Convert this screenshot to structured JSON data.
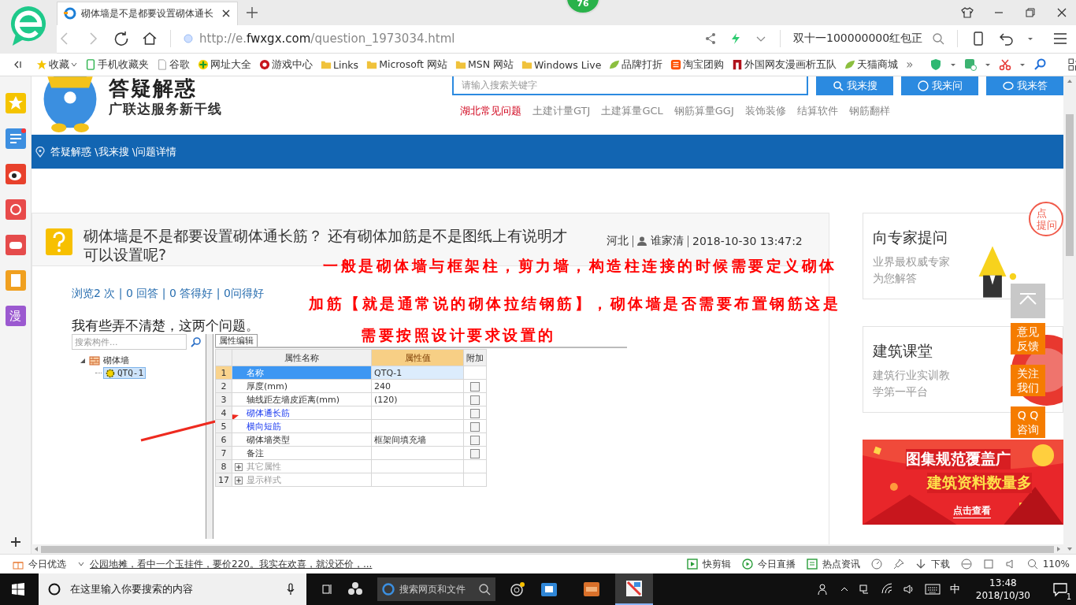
{
  "browser": {
    "tab_title": "砌体墙是不是都要设置砌体通长",
    "badge": "76",
    "url_prefix": "http://e.",
    "url_domain": "fwxgx.com",
    "url_path": "/question_1973034.html",
    "search_value": "双十一100000000红包正"
  },
  "bookmarks": [
    {
      "label": "收藏",
      "kind": "star"
    },
    {
      "label": "手机收藏夹",
      "kind": "phone"
    },
    {
      "label": "谷歌",
      "kind": "page"
    },
    {
      "label": "网址大全",
      "kind": "plus"
    },
    {
      "label": "游戏中心",
      "kind": "game"
    },
    {
      "label": "Links",
      "kind": "folder"
    },
    {
      "label": "Microsoft 网站",
      "kind": "folder"
    },
    {
      "label": "MSN 网站",
      "kind": "folder"
    },
    {
      "label": "Windows Live",
      "kind": "folder"
    },
    {
      "label": "品牌打折",
      "kind": "leaf"
    },
    {
      "label": "淘宝团购",
      "kind": "tao"
    },
    {
      "label": "外国网友漫画析五队",
      "kind": "flag"
    },
    {
      "label": "天猫商城",
      "kind": "leaf"
    }
  ],
  "bookmarks_more": "»",
  "rail_label": "漫",
  "site": {
    "title": "答疑解惑",
    "subtitle": "广联达服务新干线",
    "search_placeholder": "请输入搜索关键字",
    "buttons": [
      "我来搜",
      "我来问",
      "我来答"
    ],
    "links": [
      {
        "label": "湖北常见问题",
        "selected": true
      },
      {
        "label": "土建计量GTJ",
        "selected": false
      },
      {
        "label": "土建算量GCL",
        "selected": false
      },
      {
        "label": "钢筋算量GGJ",
        "selected": false
      },
      {
        "label": "装饰装修",
        "selected": false
      },
      {
        "label": "结算软件",
        "selected": false
      },
      {
        "label": "钢筋翻样",
        "selected": false
      }
    ],
    "breadcrumb": "答疑解惑 \\我来搜 \\问题详情"
  },
  "question": {
    "title": "砌体墙是不是都要设置砌体通长筋？ 还有砌体加筋是不是图纸上有说明才可以设置呢?",
    "region": "河北",
    "user": "谁家清",
    "time": "2018-10-30 13:47:2",
    "stats": "浏览2 次 | 0 回答 | 0 答得好 | 0问得好",
    "body": "我有些弄不清楚，这两个问题。"
  },
  "annotation": [
    "一般是砌体墙与框架柱，剪力墙，构造柱连接的时候需要定义砌体",
    "加筋【就是通常说的砌体拉结钢筋】，砌体墙是否需要布置钢筋这是",
    "需要按照设计要求设置的"
  ],
  "software": {
    "search_placeholder": "搜索构件...",
    "tree": [
      {
        "label": "砌体墙",
        "expanded": true,
        "children": [
          {
            "label": "QTQ-1",
            "selected": true
          }
        ]
      }
    ],
    "tab": "属性编辑",
    "columns": [
      "属性名称",
      "属性值",
      "附加"
    ],
    "rows": [
      {
        "num": "1",
        "name": "名称",
        "value": "QTQ-1",
        "kind": "field",
        "selected": true
      },
      {
        "num": "2",
        "name": "厚度(mm)",
        "value": "240",
        "kind": "field",
        "selected": false,
        "checked": false
      },
      {
        "num": "3",
        "name": "轴线距左墙皮距离(mm)",
        "value": "(120)",
        "kind": "field",
        "selected": false,
        "checked": false
      },
      {
        "num": "4",
        "name": "砌体通长筋",
        "kind": "link",
        "selected": false,
        "checked": false
      },
      {
        "num": "5",
        "name": "横向短筋",
        "kind": "link",
        "selected": false,
        "checked": false
      },
      {
        "num": "6",
        "name": "砌体墙类型",
        "value": "框架间填充墙",
        "kind": "field",
        "selected": false,
        "checked": false
      },
      {
        "num": "7",
        "name": "备注",
        "kind": "field",
        "selected": false,
        "checked": false
      },
      {
        "num": "8",
        "name": "其它属性",
        "kind": "group",
        "selected": false
      },
      {
        "num": "17",
        "name": "显示样式",
        "kind": "group",
        "selected": false
      }
    ]
  },
  "side_cards": [
    {
      "title": "向专家提问",
      "lines": [
        "业界最权威专家",
        "为您解答"
      ],
      "badge": [
        "点",
        "提问"
      ],
      "kind": "expert"
    },
    {
      "title": "建筑课堂",
      "lines": [
        "建筑行业实训教",
        "学第一平台"
      ],
      "kind": "school"
    }
  ],
  "ad": {
    "line1": "图集规范覆盖广",
    "line2": "建筑资料数量多",
    "button": "点击查看"
  },
  "float_buttons": [
    [
      "意见",
      "反馈"
    ],
    [
      "关注",
      "我们"
    ],
    [
      "Q Q",
      "咨询"
    ]
  ],
  "status_bar": {
    "today": "今日优选",
    "news": "公园地摊，看中一个玉挂件，要价220。我实在欢喜，就没还价，...",
    "items": [
      "快剪辑",
      "今日直播",
      "热点资讯"
    ],
    "download": "下载",
    "zoom": "110%"
  },
  "taskbar": {
    "search_placeholder": "在这里输入你要搜索的内容",
    "web_search": "搜索网页和文件",
    "ime": "中",
    "time": "13:48",
    "date": "2018/10/30",
    "notifications": "1"
  }
}
